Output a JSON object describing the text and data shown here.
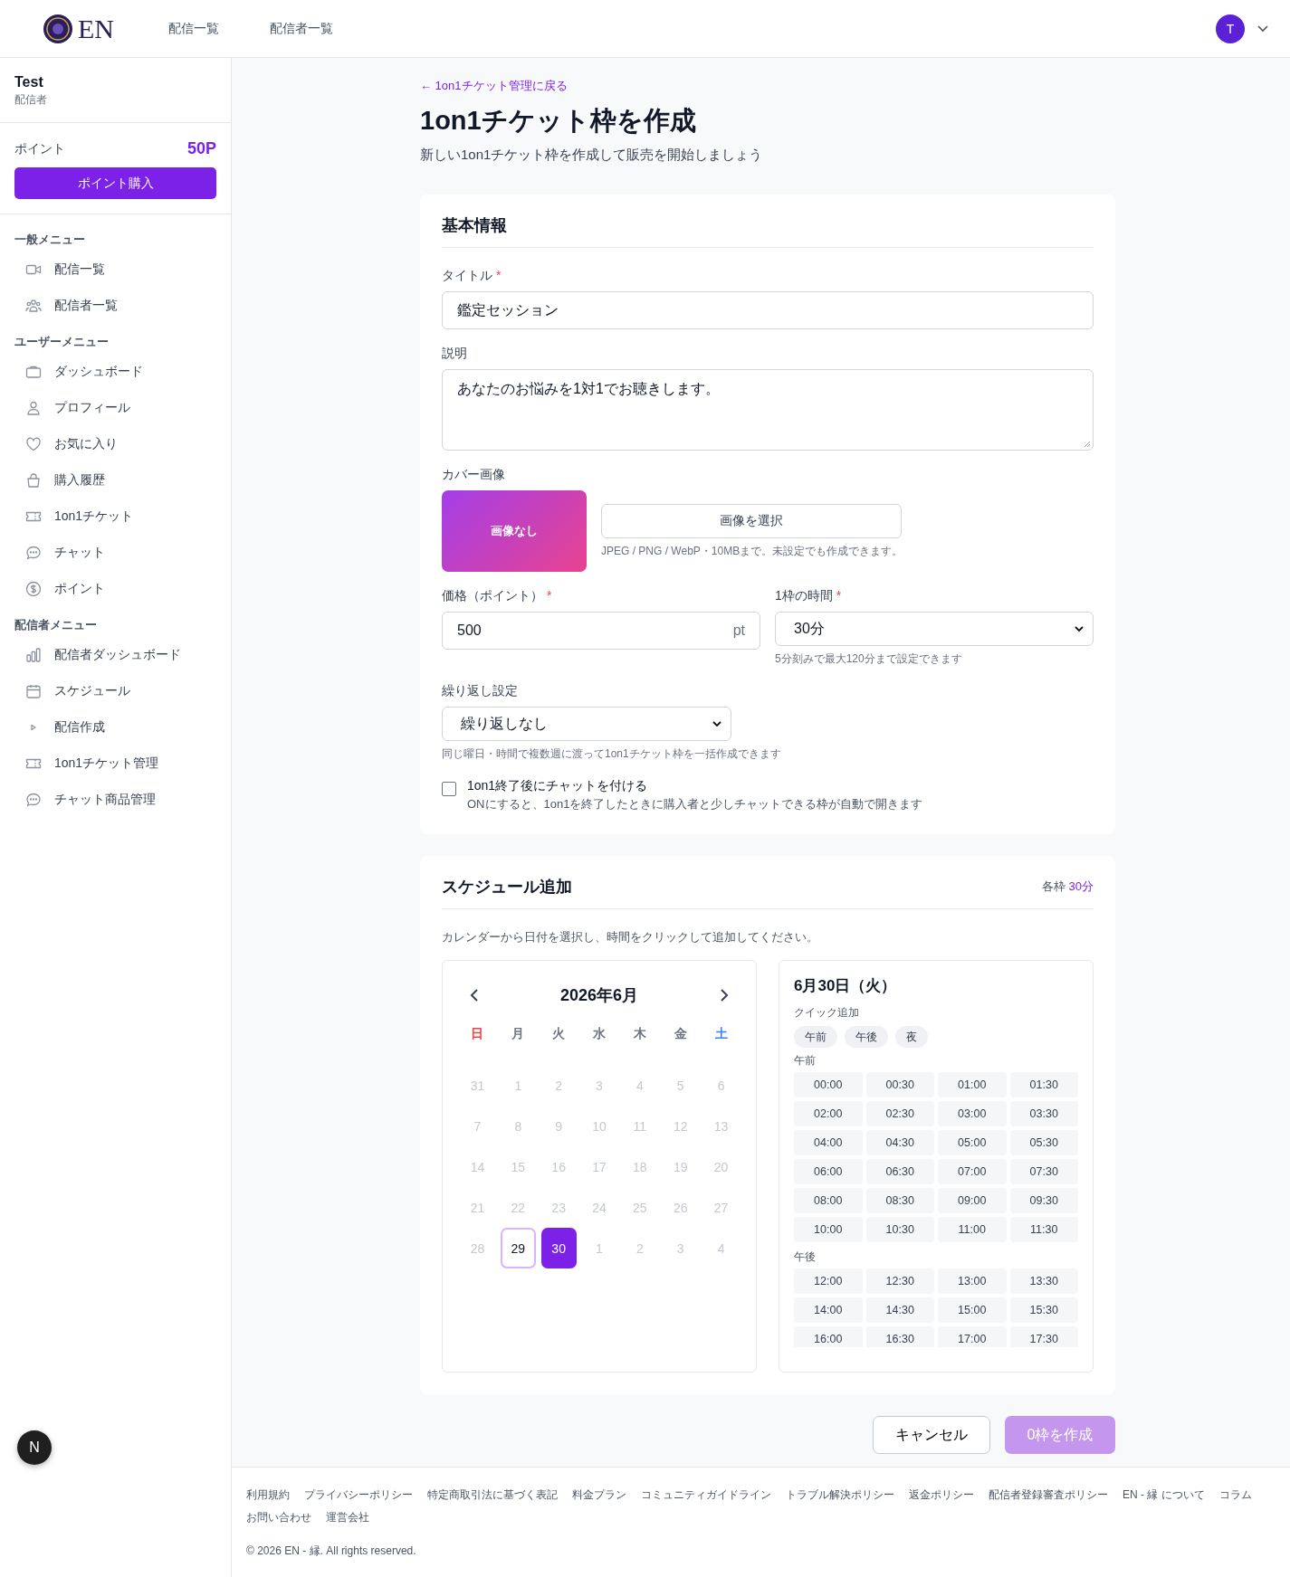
{
  "header": {
    "logo_text": "EN",
    "nav": [
      "配信一覧",
      "配信者一覧"
    ],
    "avatar": "T"
  },
  "sidebar": {
    "user_name": "Test",
    "user_role": "配信者",
    "points_label": "ポイント",
    "points_value": "50P",
    "buy_button": "ポイント購入",
    "sections": [
      {
        "title": "一般メニュー",
        "items": [
          {
            "label": "配信一覧",
            "kind": "video"
          },
          {
            "label": "配信者一覧",
            "kind": "users"
          }
        ]
      },
      {
        "title": "ユーザーメニュー",
        "items": [
          {
            "label": "ダッシュボード",
            "kind": "briefcase"
          },
          {
            "label": "プロフィール",
            "kind": "user"
          },
          {
            "label": "お気に入り",
            "kind": "heart"
          },
          {
            "label": "購入履歴",
            "kind": "bag"
          },
          {
            "label": "1on1チケット",
            "kind": "ticket"
          },
          {
            "label": "チャット",
            "kind": "chat"
          },
          {
            "label": "ポイント",
            "kind": "coin"
          }
        ]
      },
      {
        "title": "配信者メニュー",
        "items": [
          {
            "label": "配信者ダッシュボード",
            "kind": "chart"
          },
          {
            "label": "スケジュール",
            "kind": "calendar"
          },
          {
            "label": "配信作成",
            "kind": "play"
          },
          {
            "label": "1on1チケット管理",
            "kind": "ticket"
          },
          {
            "label": "チャット商品管理",
            "kind": "chat"
          }
        ]
      }
    ]
  },
  "page": {
    "back_link": "← 1on1チケット管理に戻る",
    "title": "1on1チケット枠を作成",
    "subtitle": "新しい1on1チケット枠を作成して販売を開始しましょう"
  },
  "basic_info": {
    "heading": "基本情報",
    "required_mark": "*",
    "title_label": "タイトル",
    "title_value": "鑑定セッション",
    "description_label": "説明",
    "description_value": "あなたのお悩みを1対1でお聴きします。",
    "cover_label": "カバー画像",
    "cover_placeholder": "画像なし",
    "cover_button": "画像を選択",
    "cover_hint": "JPEG / PNG / WebP・10MBまで。未設定でも作成できます。",
    "price_label": "価格（ポイント）",
    "price_value": "500",
    "price_unit": "pt",
    "duration_label": "1枠の時間",
    "duration_value": "30分",
    "duration_hint": "5分刻みで最大120分まで設定できます",
    "repeat_label": "繰り返し設定",
    "repeat_value": "繰り返しなし",
    "repeat_hint": "同じ曜日・時間で複数週に渡って1on1チケット枠を一括作成できます",
    "chat_option": {
      "label": "1on1終了後にチャットを付ける",
      "description": "ONにすると、1on1を終了したときに購入者と少しチャットできる枠が自動で開きます",
      "checked": false
    }
  },
  "schedule": {
    "heading": "スケジュール追加",
    "slot_label": "各枠",
    "slot_value": "30分",
    "instruction": "カレンダーから日付を選択し、時間をクリックして追加してください。",
    "calendar": {
      "month": "2026年6月",
      "weekdays": [
        {
          "label": "日",
          "color": "#ef4444"
        },
        {
          "label": "月",
          "color": "#6b7280"
        },
        {
          "label": "火",
          "color": "#6b7280"
        },
        {
          "label": "水",
          "color": "#6b7280"
        },
        {
          "label": "木",
          "color": "#6b7280"
        },
        {
          "label": "金",
          "color": "#6b7280"
        },
        {
          "label": "土",
          "color": "#3b82f6"
        }
      ],
      "days": [
        {
          "label": "31",
          "disabled": true,
          "today": false,
          "selected": false
        },
        {
          "label": "1",
          "disabled": true,
          "today": false,
          "selected": false
        },
        {
          "label": "2",
          "disabled": true,
          "today": false,
          "selected": false
        },
        {
          "label": "3",
          "disabled": true,
          "today": false,
          "selected": false
        },
        {
          "label": "4",
          "disabled": true,
          "today": false,
          "selected": false
        },
        {
          "label": "5",
          "disabled": true,
          "today": false,
          "selected": false
        },
        {
          "label": "6",
          "disabled": true,
          "today": false,
          "selected": false
        },
        {
          "label": "7",
          "disabled": true,
          "today": false,
          "selected": false
        },
        {
          "label": "8",
          "disabled": true,
          "today": false,
          "selected": false
        },
        {
          "label": "9",
          "disabled": true,
          "today": false,
          "selected": false
        },
        {
          "label": "10",
          "disabled": true,
          "today": false,
          "selected": false
        },
        {
          "label": "11",
          "disabled": true,
          "today": false,
          "selected": false
        },
        {
          "label": "12",
          "disabled": true,
          "today": false,
          "selected": false
        },
        {
          "label": "13",
          "disabled": true,
          "today": false,
          "selected": false
        },
        {
          "label": "14",
          "disabled": true,
          "today": false,
          "selected": false
        },
        {
          "label": "15",
          "disabled": true,
          "today": false,
          "selected": false
        },
        {
          "label": "16",
          "disabled": true,
          "today": false,
          "selected": false
        },
        {
          "label": "17",
          "disabled": true,
          "today": false,
          "selected": false
        },
        {
          "label": "18",
          "disabled": true,
          "today": false,
          "selected": false
        },
        {
          "label": "19",
          "disabled": true,
          "today": false,
          "selected": false
        },
        {
          "label": "20",
          "disabled": true,
          "today": false,
          "selected": false
        },
        {
          "label": "21",
          "disabled": true,
          "today": false,
          "selected": false
        },
        {
          "label": "22",
          "disabled": true,
          "today": false,
          "selected": false
        },
        {
          "label": "23",
          "disabled": true,
          "today": false,
          "selected": false
        },
        {
          "label": "24",
          "disabled": true,
          "today": false,
          "selected": false
        },
        {
          "label": "25",
          "disabled": true,
          "today": false,
          "selected": false
        },
        {
          "label": "26",
          "disabled": true,
          "today": false,
          "selected": false
        },
        {
          "label": "27",
          "disabled": true,
          "today": false,
          "selected": false
        },
        {
          "label": "28",
          "disabled": true,
          "today": false,
          "selected": false
        },
        {
          "label": "29",
          "disabled": false,
          "today": true,
          "selected": false
        },
        {
          "label": "30",
          "disabled": false,
          "today": false,
          "selected": true
        },
        {
          "label": "1",
          "disabled": true,
          "today": false,
          "selected": false
        },
        {
          "label": "2",
          "disabled": true,
          "today": false,
          "selected": false
        },
        {
          "label": "3",
          "disabled": true,
          "today": false,
          "selected": false
        },
        {
          "label": "4",
          "disabled": true,
          "today": false,
          "selected": false
        }
      ]
    },
    "day_panel": {
      "date": "6月30日（火）",
      "quick_label": "クイック追加",
      "quick_buttons": [
        "午前",
        "午後",
        "夜"
      ],
      "groups": [
        {
          "label": "午前",
          "times": [
            "00:00",
            "00:30",
            "01:00",
            "01:30",
            "02:00",
            "02:30",
            "03:00",
            "03:30",
            "04:00",
            "04:30",
            "05:00",
            "05:30",
            "06:00",
            "06:30",
            "07:00",
            "07:30",
            "08:00",
            "08:30",
            "09:00",
            "09:30",
            "10:00",
            "10:30",
            "11:00",
            "11:30"
          ]
        },
        {
          "label": "午後",
          "times": [
            "12:00",
            "12:30",
            "13:00",
            "13:30",
            "14:00",
            "14:30",
            "15:00",
            "15:30",
            "16:00",
            "16:30",
            "17:00",
            "17:30"
          ]
        }
      ]
    }
  },
  "actions": {
    "cancel": "キャンセル",
    "submit": {
      "label": "0枠を作成",
      "disabled": true
    }
  },
  "footer": {
    "links": [
      "利用規約",
      "プライバシーポリシー",
      "特定商取引法に基づく表記",
      "料金プラン",
      "コミュニティガイドライン",
      "トラブル解決ポリシー",
      "返金ポリシー",
      "配信者登録審査ポリシー",
      "EN - 縁 について",
      "コラム",
      "お問い合わせ",
      "運営会社"
    ],
    "copyright": "© 2026 EN - 縁. All rights reserved."
  },
  "dev_badge": "N"
}
